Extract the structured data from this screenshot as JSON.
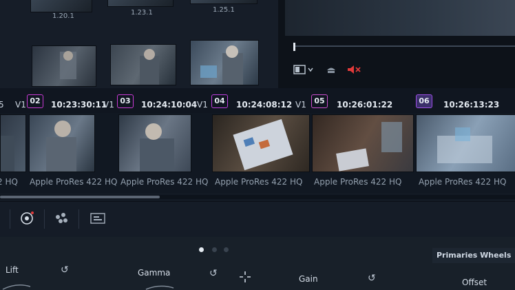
{
  "gallery": {
    "still_labels": [
      "1.20.1",
      "1.23.1",
      "1.25.1"
    ]
  },
  "clips": [
    {
      "track": "V1",
      "number": "02",
      "timecode": "10:23:30:11",
      "codec": "Apple ProRes 422 HQ",
      "color": "#cc3bd6"
    },
    {
      "track": "V1",
      "number": "03",
      "timecode": "10:24:10:04",
      "codec": "Apple ProRes 422 HQ",
      "color": "#cc3bd6"
    },
    {
      "track": "V1",
      "number": "04",
      "timecode": "10:24:08:12",
      "codec": "Apple ProRes 422 HQ",
      "color": "#c23fe0"
    },
    {
      "track": "V1",
      "number": "05",
      "timecode": "10:26:01:22",
      "codec": "Apple ProRes 422 HQ",
      "color": "#cf4fd0"
    },
    {
      "track": "",
      "number": "06",
      "timecode": "10:26:13:23",
      "codec": "Apple ProRes 422 HQ",
      "color": "#a050e8"
    }
  ],
  "clipbar_partial": {
    "prefix": "5",
    "left_codec": "2 HQ"
  },
  "toolbar": {
    "icons": [
      "target-icon",
      "nodes-icon",
      "media-icon"
    ]
  },
  "panel": {
    "title": "Primaries Wheels",
    "wheels": [
      "Lift",
      "Gamma",
      "Gain",
      "Offset"
    ],
    "page_dots": 3,
    "active_dot": 0
  },
  "viewer": {
    "mute_color": "#e23a3a"
  }
}
